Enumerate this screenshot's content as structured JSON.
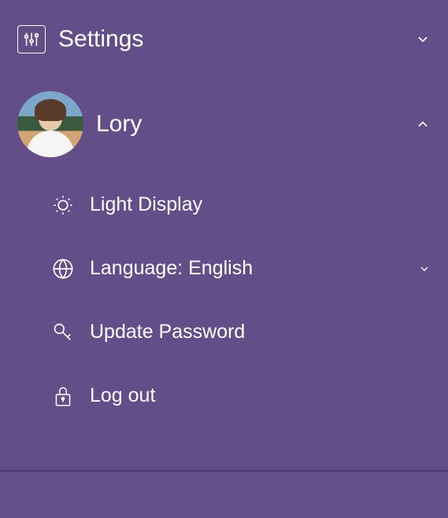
{
  "settings": {
    "label": "Settings"
  },
  "user": {
    "name": "Lory"
  },
  "menu": {
    "light_display": "Light Display",
    "language": "Language: English",
    "update_password": "Update Password",
    "log_out": "Log out"
  }
}
